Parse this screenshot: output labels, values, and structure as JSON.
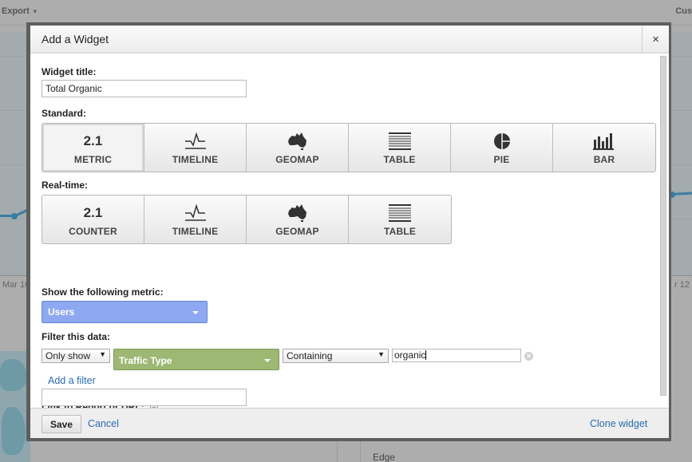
{
  "background": {
    "toolbar": {
      "export_label": "Export",
      "right_label": "Cus"
    },
    "chart": {
      "x_labels": [
        "Mar 10",
        "r 12"
      ]
    },
    "table": {
      "row_label": "Edge"
    }
  },
  "modal": {
    "title": "Add a Widget",
    "close_label": "×",
    "widget_title_label": "Widget title:",
    "widget_title_value": "Total Organic",
    "standard_label": "Standard:",
    "standard_types": [
      {
        "icon": "metric-number-icon",
        "icon_text": "2.1",
        "label": "METRIC",
        "selected": true
      },
      {
        "icon": "timeline-icon",
        "label": "TIMELINE",
        "selected": false
      },
      {
        "icon": "geomap-icon",
        "label": "GEOMAP",
        "selected": false
      },
      {
        "icon": "table-icon",
        "label": "TABLE",
        "selected": false
      },
      {
        "icon": "pie-icon",
        "label": "PIE",
        "selected": false
      },
      {
        "icon": "bar-icon",
        "label": "BAR",
        "selected": false
      }
    ],
    "realtime_label": "Real-time:",
    "realtime_types": [
      {
        "icon": "counter-number-icon",
        "icon_text": "2.1",
        "label": "COUNTER"
      },
      {
        "icon": "timeline-icon",
        "label": "TIMELINE"
      },
      {
        "icon": "geomap-icon",
        "label": "GEOMAP"
      },
      {
        "icon": "table-icon",
        "label": "TABLE"
      }
    ],
    "metric_label": "Show the following metric:",
    "metric_value": "Users",
    "filter_label": "Filter this data:",
    "filter": {
      "mode": "Only show",
      "dimension": "Traffic Type",
      "operator": "Containing",
      "value": "organic"
    },
    "add_filter_label": "Add a filter",
    "link_label": "Link to Report or URL:",
    "link_value": "",
    "save_label": "Save",
    "cancel_label": "Cancel",
    "clone_label": "Clone widget"
  },
  "colors": {
    "metric_select": "#8ea8f2",
    "dimension_select": "#9cb873",
    "link": "#2a6db0"
  }
}
